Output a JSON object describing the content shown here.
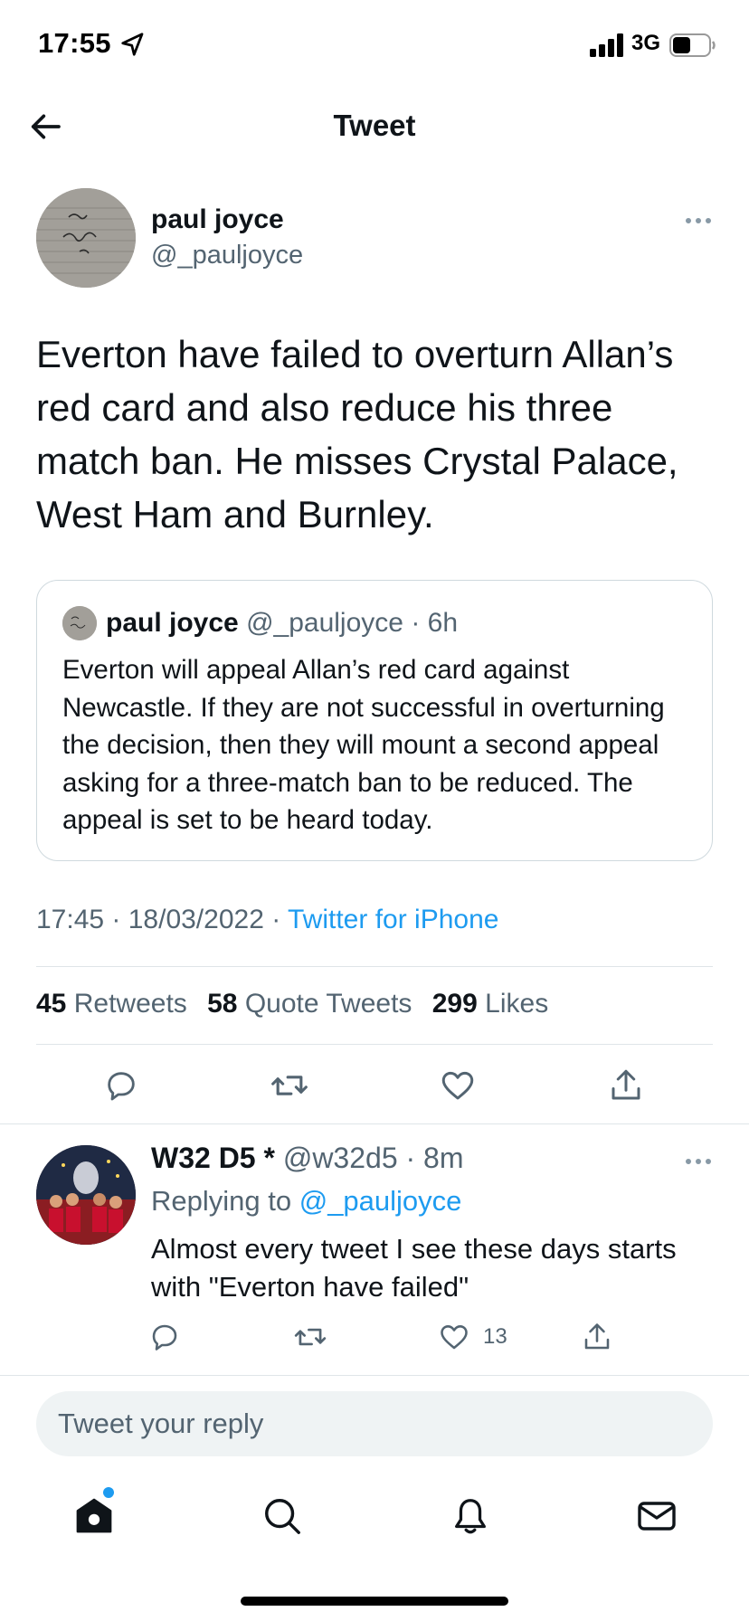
{
  "status_bar": {
    "time": "17:55",
    "network": "3G"
  },
  "header": {
    "title": "Tweet",
    "back_icon": "arrow-left-icon"
  },
  "tweet": {
    "author_name": "paul joyce",
    "author_handle": "@_pauljoyce",
    "text": "Everton have failed to overturn Allan’s red card and also reduce his three match ban. He misses Crystal Palace, West Ham and Burnley.",
    "quoted": {
      "author_name": "paul joyce",
      "author_handle": "@_pauljoyce",
      "time": "· 6h",
      "text": "Everton will appeal Allan’s red card against Newcastle. If they are not successful in overturning the decision, then they will mount a second appeal asking for a three-match ban to be reduced. The appeal is set to be heard today."
    },
    "timestamp": "17:45 · 18/03/2022 ·",
    "source": "Twitter for iPhone",
    "stats": {
      "retweets_count": "45",
      "retweets_label": "Retweets",
      "quotes_count": "58",
      "quotes_label": "Quote Tweets",
      "likes_count": "299",
      "likes_label": "Likes"
    }
  },
  "reply": {
    "author_name": "W32 D5 *",
    "author_handle": "@w32d5",
    "time": "· 8m",
    "replying_prefix": "Replying to",
    "replying_to": "@_pauljoyce",
    "text": "Almost every tweet I see these days starts with \"Everton have failed\"",
    "like_count": "13"
  },
  "compose": {
    "placeholder": "Tweet your reply"
  },
  "tab_bar": {
    "items": [
      "home-icon",
      "search-icon",
      "notifications-icon",
      "messages-icon"
    ]
  },
  "colors": {
    "accent": "#1d9bf0",
    "text_primary": "#0f1419",
    "text_secondary": "#536471",
    "divider": "#dfe5e8"
  }
}
